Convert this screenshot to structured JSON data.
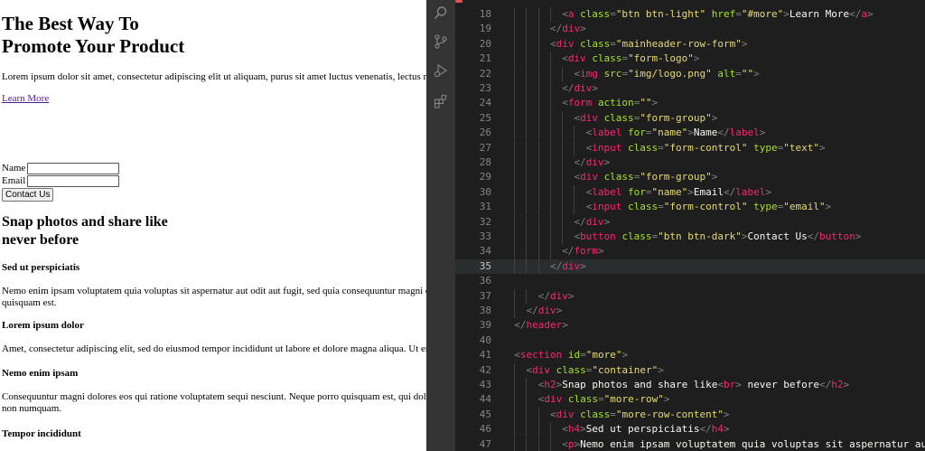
{
  "preview": {
    "hero_title_line1": "The Best Way To",
    "hero_title_line2": "Promote Your Product",
    "hero_lead": "Lorem ipsum dolor sit amet, consectetur adipiscing elit ut aliquam, purus sit amet luctus venenatis, lectus m",
    "learn_more": "Learn More",
    "form": {
      "name_label": "Name",
      "email_label": "Email",
      "name_value": "",
      "email_value": "",
      "submit_label": "Contact Us"
    },
    "section_title_line1": "Snap photos and share like",
    "section_title_line2": "never before",
    "items": [
      {
        "heading": "Sed ut perspiciatis",
        "lines": [
          "Nemo enim ipsam voluptatem quia voluptas sit aspernatur aut odit aut fugit, sed quia consequuntur magni d",
          "quisquam est."
        ]
      },
      {
        "heading": "Lorem ipsum dolor",
        "lines": [
          "Amet, consectetur adipiscing elit, sed do eiusmod tempor incididunt ut labore et dolore magna aliqua. Ut en"
        ]
      },
      {
        "heading": "Nemo enim ipsam",
        "lines": [
          "Consequuntur magni dolores eos qui ratione voluptatem sequi nesciunt. Neque porro quisquam est, qui dolo",
          "non numquam."
        ]
      },
      {
        "heading": "Tempor incididunt",
        "lines": []
      }
    ]
  },
  "editor": {
    "activity_icons": [
      "search-icon",
      "source-control-icon",
      "run-debug-icon",
      "extensions-icon"
    ],
    "current_line": 35,
    "lines": [
      {
        "n": 18,
        "indent": 5,
        "tokens": [
          [
            "punc",
            "<"
          ],
          [
            "tag",
            "a"
          ],
          [
            "txt",
            " "
          ],
          [
            "attr",
            "class"
          ],
          [
            "punc",
            "="
          ],
          [
            "str",
            "\"btn btn-light\""
          ],
          [
            "txt",
            " "
          ],
          [
            "attr",
            "href"
          ],
          [
            "punc",
            "="
          ],
          [
            "str",
            "\"#more\""
          ],
          [
            "punc",
            ">"
          ],
          [
            "txt",
            "Learn More"
          ],
          [
            "punc",
            "</"
          ],
          [
            "tag",
            "a"
          ],
          [
            "punc",
            ">"
          ]
        ]
      },
      {
        "n": 19,
        "indent": 4,
        "tokens": [
          [
            "punc",
            "</"
          ],
          [
            "tag",
            "div"
          ],
          [
            "punc",
            ">"
          ]
        ]
      },
      {
        "n": 20,
        "indent": 4,
        "tokens": [
          [
            "punc",
            "<"
          ],
          [
            "tag",
            "div"
          ],
          [
            "txt",
            " "
          ],
          [
            "attr",
            "class"
          ],
          [
            "punc",
            "="
          ],
          [
            "str",
            "\"mainheader-row-form\""
          ],
          [
            "punc",
            ">"
          ]
        ]
      },
      {
        "n": 21,
        "indent": 5,
        "tokens": [
          [
            "punc",
            "<"
          ],
          [
            "tag",
            "div"
          ],
          [
            "txt",
            " "
          ],
          [
            "attr",
            "class"
          ],
          [
            "punc",
            "="
          ],
          [
            "str",
            "\"form-logo\""
          ],
          [
            "punc",
            ">"
          ]
        ]
      },
      {
        "n": 22,
        "indent": 6,
        "tokens": [
          [
            "punc",
            "<"
          ],
          [
            "tag",
            "img"
          ],
          [
            "txt",
            " "
          ],
          [
            "attr",
            "src"
          ],
          [
            "punc",
            "="
          ],
          [
            "str",
            "\"img/logo.png\""
          ],
          [
            "txt",
            " "
          ],
          [
            "attr",
            "alt"
          ],
          [
            "punc",
            "="
          ],
          [
            "str",
            "\"\""
          ],
          [
            "punc",
            ">"
          ]
        ]
      },
      {
        "n": 23,
        "indent": 5,
        "tokens": [
          [
            "punc",
            "</"
          ],
          [
            "tag",
            "div"
          ],
          [
            "punc",
            ">"
          ]
        ]
      },
      {
        "n": 24,
        "indent": 5,
        "tokens": [
          [
            "punc",
            "<"
          ],
          [
            "tag",
            "form"
          ],
          [
            "txt",
            " "
          ],
          [
            "attr",
            "action"
          ],
          [
            "punc",
            "="
          ],
          [
            "str",
            "\"\""
          ],
          [
            "punc",
            ">"
          ]
        ]
      },
      {
        "n": 25,
        "indent": 6,
        "tokens": [
          [
            "punc",
            "<"
          ],
          [
            "tag",
            "div"
          ],
          [
            "txt",
            " "
          ],
          [
            "attr",
            "class"
          ],
          [
            "punc",
            "="
          ],
          [
            "str",
            "\"form-group\""
          ],
          [
            "punc",
            ">"
          ]
        ]
      },
      {
        "n": 26,
        "indent": 7,
        "tokens": [
          [
            "punc",
            "<"
          ],
          [
            "tag",
            "label"
          ],
          [
            "txt",
            " "
          ],
          [
            "attr",
            "for"
          ],
          [
            "punc",
            "="
          ],
          [
            "str",
            "\"name\""
          ],
          [
            "punc",
            ">"
          ],
          [
            "txt",
            "Name"
          ],
          [
            "punc",
            "</"
          ],
          [
            "tag",
            "label"
          ],
          [
            "punc",
            ">"
          ]
        ]
      },
      {
        "n": 27,
        "indent": 7,
        "tokens": [
          [
            "punc",
            "<"
          ],
          [
            "tag",
            "input"
          ],
          [
            "txt",
            " "
          ],
          [
            "attr",
            "class"
          ],
          [
            "punc",
            "="
          ],
          [
            "str",
            "\"form-control\""
          ],
          [
            "txt",
            " "
          ],
          [
            "attr",
            "type"
          ],
          [
            "punc",
            "="
          ],
          [
            "str",
            "\"text\""
          ],
          [
            "punc",
            ">"
          ]
        ]
      },
      {
        "n": 28,
        "indent": 6,
        "tokens": [
          [
            "punc",
            "</"
          ],
          [
            "tag",
            "div"
          ],
          [
            "punc",
            ">"
          ]
        ]
      },
      {
        "n": 29,
        "indent": 6,
        "tokens": [
          [
            "punc",
            "<"
          ],
          [
            "tag",
            "div"
          ],
          [
            "txt",
            " "
          ],
          [
            "attr",
            "class"
          ],
          [
            "punc",
            "="
          ],
          [
            "str",
            "\"form-group\""
          ],
          [
            "punc",
            ">"
          ]
        ]
      },
      {
        "n": 30,
        "indent": 7,
        "tokens": [
          [
            "punc",
            "<"
          ],
          [
            "tag",
            "label"
          ],
          [
            "txt",
            " "
          ],
          [
            "attr",
            "for"
          ],
          [
            "punc",
            "="
          ],
          [
            "str",
            "\"name\""
          ],
          [
            "punc",
            ">"
          ],
          [
            "txt",
            "Email"
          ],
          [
            "punc",
            "</"
          ],
          [
            "tag",
            "label"
          ],
          [
            "punc",
            ">"
          ]
        ]
      },
      {
        "n": 31,
        "indent": 7,
        "tokens": [
          [
            "punc",
            "<"
          ],
          [
            "tag",
            "input"
          ],
          [
            "txt",
            " "
          ],
          [
            "attr",
            "class"
          ],
          [
            "punc",
            "="
          ],
          [
            "str",
            "\"form-control\""
          ],
          [
            "txt",
            " "
          ],
          [
            "attr",
            "type"
          ],
          [
            "punc",
            "="
          ],
          [
            "str",
            "\"email\""
          ],
          [
            "punc",
            ">"
          ]
        ]
      },
      {
        "n": 32,
        "indent": 6,
        "tokens": [
          [
            "punc",
            "</"
          ],
          [
            "tag",
            "div"
          ],
          [
            "punc",
            ">"
          ]
        ]
      },
      {
        "n": 33,
        "indent": 6,
        "tokens": [
          [
            "punc",
            "<"
          ],
          [
            "tag",
            "button"
          ],
          [
            "txt",
            " "
          ],
          [
            "attr",
            "class"
          ],
          [
            "punc",
            "="
          ],
          [
            "str",
            "\"btn btn-dark\""
          ],
          [
            "punc",
            ">"
          ],
          [
            "txt",
            "Contact Us"
          ],
          [
            "punc",
            "</"
          ],
          [
            "tag",
            "button"
          ],
          [
            "punc",
            ">"
          ]
        ]
      },
      {
        "n": 34,
        "indent": 5,
        "tokens": [
          [
            "punc",
            "</"
          ],
          [
            "tag",
            "form"
          ],
          [
            "punc",
            ">"
          ]
        ]
      },
      {
        "n": 35,
        "indent": 4,
        "tokens": [
          [
            "punc",
            "</"
          ],
          [
            "tag",
            "div"
          ],
          [
            "punc",
            ">"
          ]
        ]
      },
      {
        "n": 36,
        "indent": 0,
        "tokens": []
      },
      {
        "n": 37,
        "indent": 3,
        "tokens": [
          [
            "punc",
            "</"
          ],
          [
            "tag",
            "div"
          ],
          [
            "punc",
            ">"
          ]
        ]
      },
      {
        "n": 38,
        "indent": 2,
        "tokens": [
          [
            "punc",
            "</"
          ],
          [
            "tag",
            "div"
          ],
          [
            "punc",
            ">"
          ]
        ]
      },
      {
        "n": 39,
        "indent": 1,
        "tokens": [
          [
            "punc",
            "</"
          ],
          [
            "tag",
            "header"
          ],
          [
            "punc",
            ">"
          ]
        ]
      },
      {
        "n": 40,
        "indent": 0,
        "tokens": []
      },
      {
        "n": 41,
        "indent": 1,
        "tokens": [
          [
            "punc",
            "<"
          ],
          [
            "tag",
            "section"
          ],
          [
            "txt",
            " "
          ],
          [
            "attr",
            "id"
          ],
          [
            "punc",
            "="
          ],
          [
            "str",
            "\"more\""
          ],
          [
            "punc",
            ">"
          ]
        ]
      },
      {
        "n": 42,
        "indent": 2,
        "tokens": [
          [
            "punc",
            "<"
          ],
          [
            "tag",
            "div"
          ],
          [
            "txt",
            " "
          ],
          [
            "attr",
            "class"
          ],
          [
            "punc",
            "="
          ],
          [
            "str",
            "\"container\""
          ],
          [
            "punc",
            ">"
          ]
        ]
      },
      {
        "n": 43,
        "indent": 3,
        "tokens": [
          [
            "punc",
            "<"
          ],
          [
            "tag",
            "h2"
          ],
          [
            "punc",
            ">"
          ],
          [
            "txt",
            "Snap photos and share like"
          ],
          [
            "punc",
            "<"
          ],
          [
            "tag",
            "br"
          ],
          [
            "punc",
            ">"
          ],
          [
            "txt",
            " never before"
          ],
          [
            "punc",
            "</"
          ],
          [
            "tag",
            "h2"
          ],
          [
            "punc",
            ">"
          ]
        ]
      },
      {
        "n": 44,
        "indent": 3,
        "tokens": [
          [
            "punc",
            "<"
          ],
          [
            "tag",
            "div"
          ],
          [
            "txt",
            " "
          ],
          [
            "attr",
            "class"
          ],
          [
            "punc",
            "="
          ],
          [
            "str",
            "\"more-row\""
          ],
          [
            "punc",
            ">"
          ]
        ]
      },
      {
        "n": 45,
        "indent": 4,
        "tokens": [
          [
            "punc",
            "<"
          ],
          [
            "tag",
            "div"
          ],
          [
            "txt",
            " "
          ],
          [
            "attr",
            "class"
          ],
          [
            "punc",
            "="
          ],
          [
            "str",
            "\"more-row-content\""
          ],
          [
            "punc",
            ">"
          ]
        ]
      },
      {
        "n": 46,
        "indent": 5,
        "tokens": [
          [
            "punc",
            "<"
          ],
          [
            "tag",
            "h4"
          ],
          [
            "punc",
            ">"
          ],
          [
            "txt",
            "Sed ut perspiciatis"
          ],
          [
            "punc",
            "</"
          ],
          [
            "tag",
            "h4"
          ],
          [
            "punc",
            ">"
          ]
        ]
      },
      {
        "n": 47,
        "indent": 5,
        "tokens": [
          [
            "punc",
            "<"
          ],
          [
            "tag",
            "p"
          ],
          [
            "punc",
            ">"
          ],
          [
            "txt",
            "Nemo enim ipsam voluptatem quia voluptas sit aspernatur au"
          ]
        ]
      }
    ]
  },
  "colors": {
    "editor_bg": "#1e1e1e",
    "activity_bg": "#333333",
    "tag": "#f92672",
    "attr": "#a6e22e",
    "string": "#e6db74",
    "text": "#f8f8f2",
    "punctuation": "#808080",
    "link": "#551a8b"
  }
}
